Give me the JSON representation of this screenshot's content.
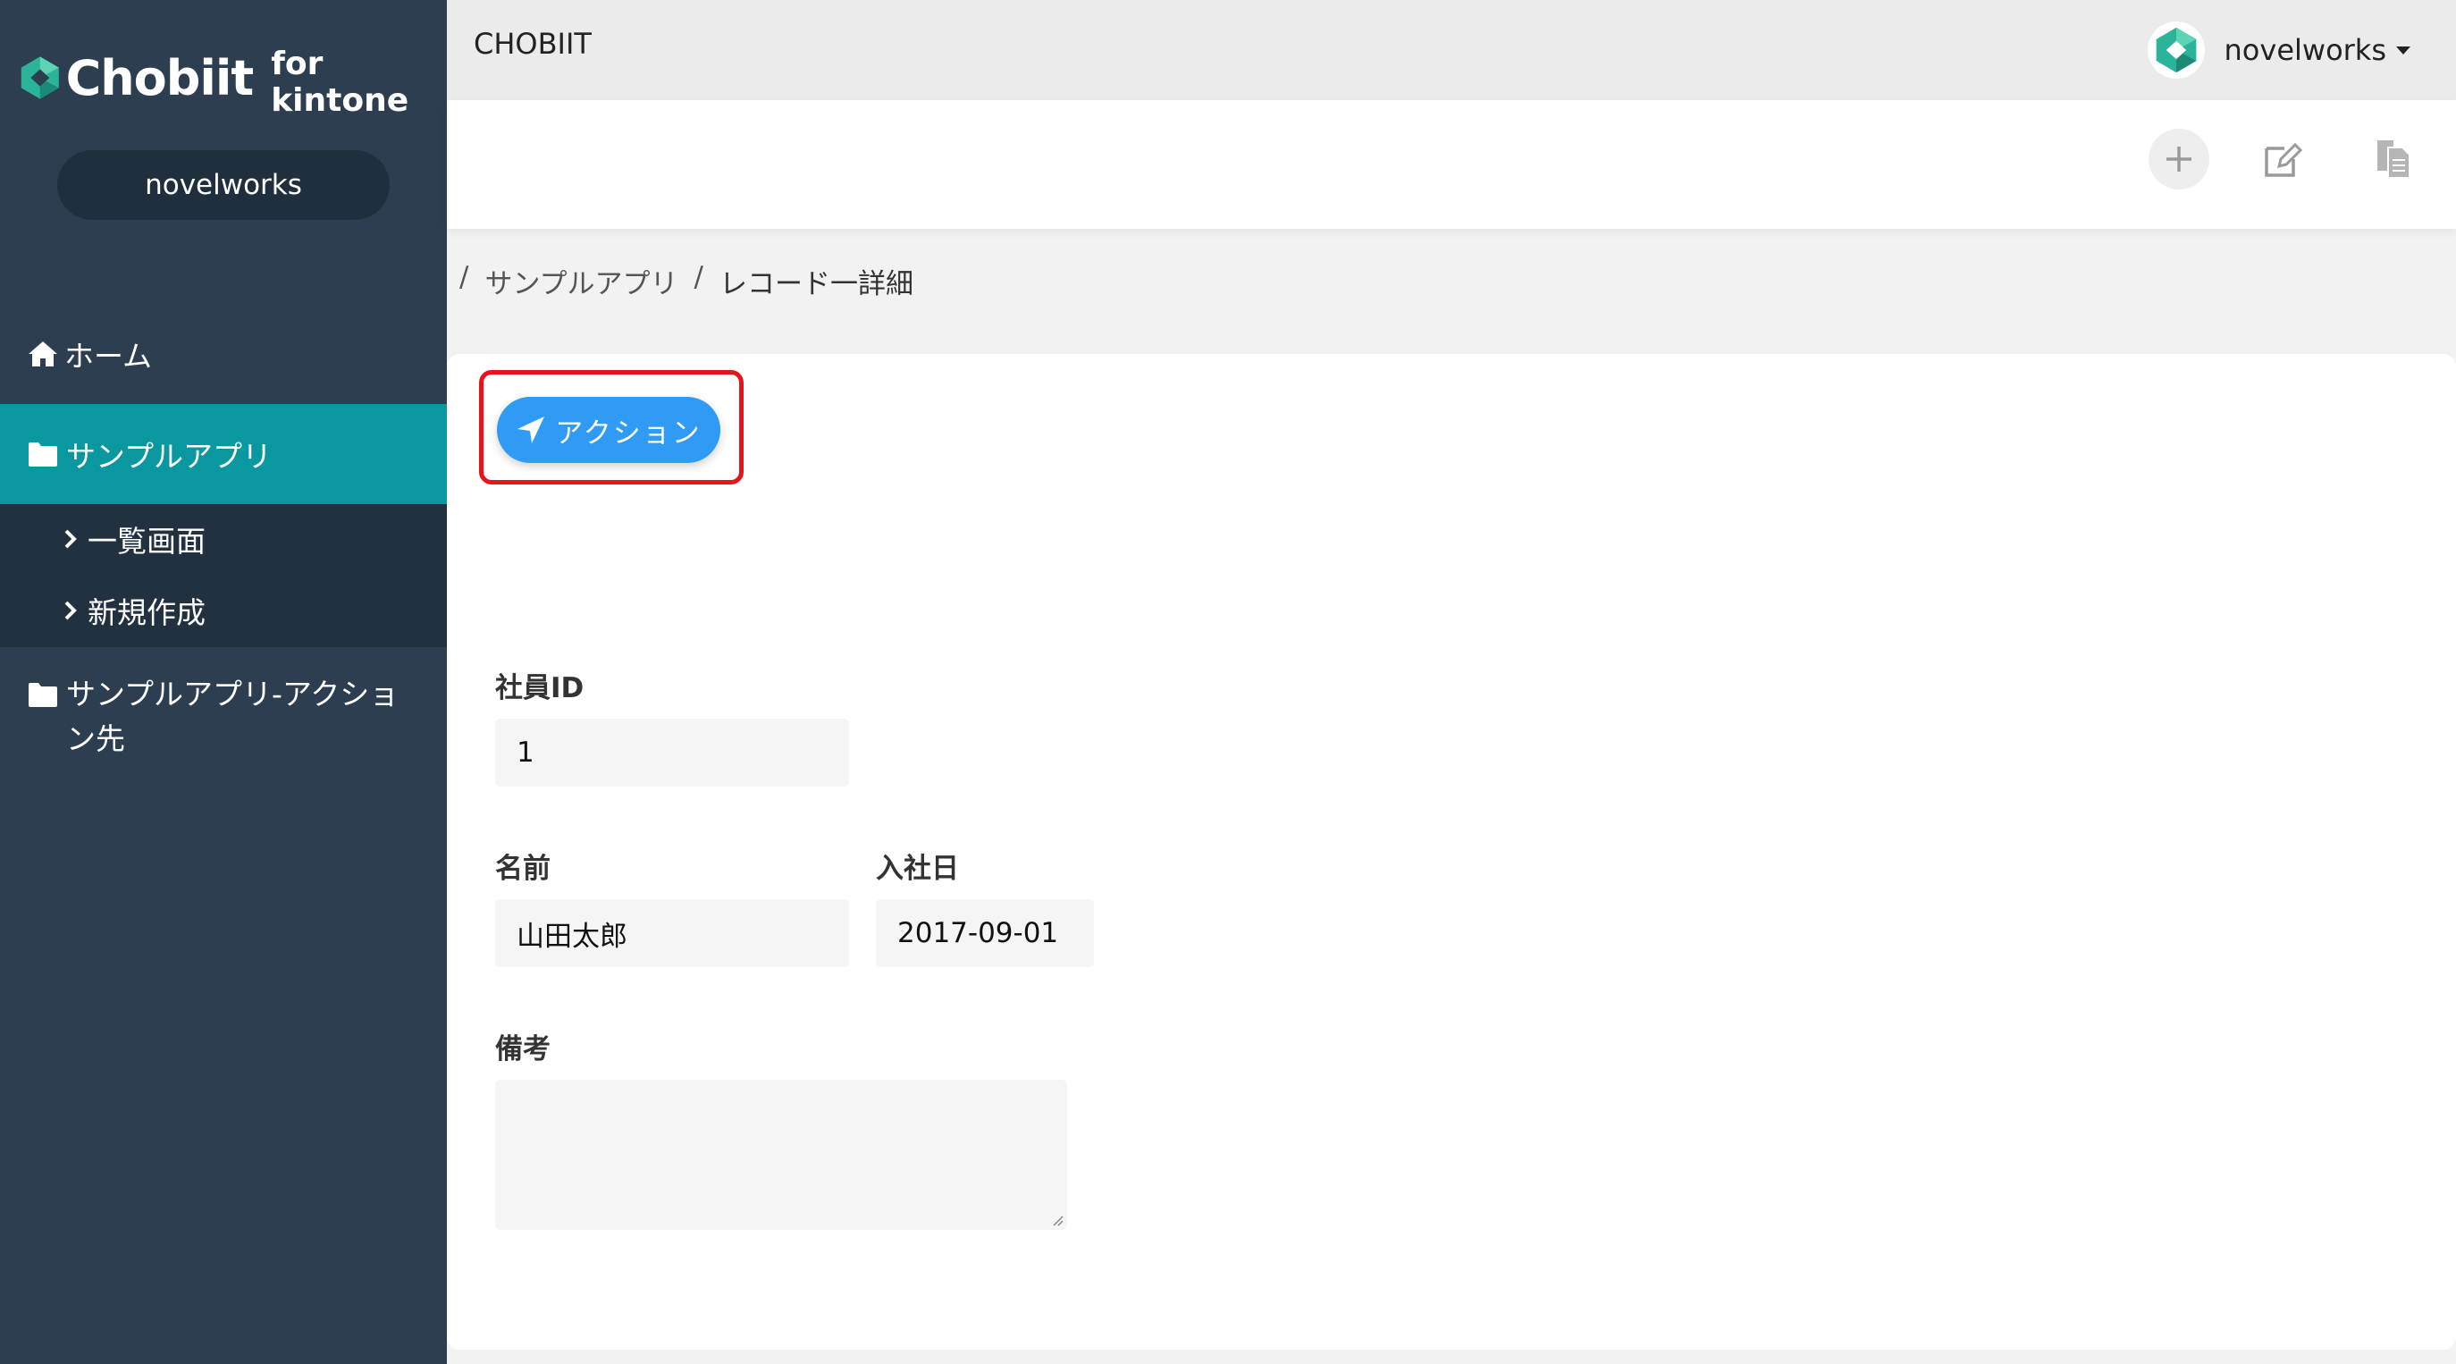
{
  "brand": {
    "name": "Chobiit",
    "sub": "for kintone",
    "accent": "#0a98a0"
  },
  "sidebar": {
    "org": "novelworks",
    "items": [
      {
        "label": "ホーム",
        "icon": "home-icon"
      },
      {
        "label": "サンプルアプリ",
        "icon": "folder-icon",
        "active": true
      },
      {
        "label": "サンプルアプリ-アクション先",
        "icon": "folder-icon"
      }
    ],
    "subitems": [
      {
        "label": "一覧画面",
        "icon": "chevron-right-icon"
      },
      {
        "label": "新規作成",
        "icon": "chevron-right-icon"
      }
    ]
  },
  "header": {
    "title": "CHOBIIT",
    "user": "novelworks"
  },
  "toolbar": {
    "icons": [
      "plus-icon",
      "edit-icon",
      "copy-icon"
    ]
  },
  "breadcrumb": {
    "sep": "/",
    "app": "サンプルアプリ",
    "current": "レコード一詳細"
  },
  "action": {
    "label": "アクション",
    "color": "#2f9bf5",
    "highlight_color": "#e8141c"
  },
  "form": {
    "employee_id": {
      "label": "社員ID",
      "value": "1"
    },
    "name": {
      "label": "名前",
      "value": "山田太郎"
    },
    "join_date": {
      "label": "入社日",
      "value": "2017-09-01"
    },
    "note": {
      "label": "備考",
      "value": ""
    }
  }
}
